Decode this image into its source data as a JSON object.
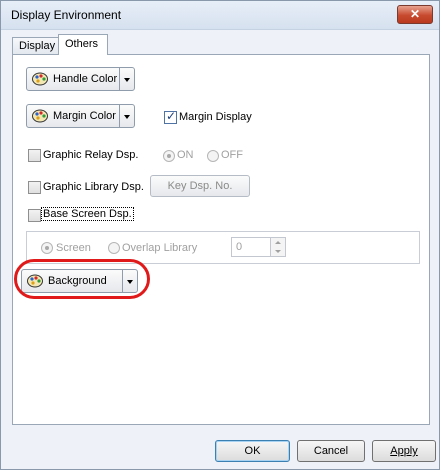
{
  "window": {
    "title": "Display Environment",
    "close_glyph": "✕"
  },
  "tabs": [
    {
      "label": "Display"
    },
    {
      "label": "Others",
      "active": true
    }
  ],
  "others": {
    "handle_color": {
      "label": "Handle Color",
      "icon": "palette-icon"
    },
    "margin_color": {
      "label": "Margin Color",
      "icon": "palette-icon"
    },
    "margin_display": {
      "label": "Margin Display",
      "checked": true
    },
    "graphic_relay": {
      "label": "Graphic Relay Dsp.",
      "checked": false,
      "on_label": "ON",
      "off_label": "OFF",
      "selected": "ON"
    },
    "graphic_library": {
      "label": "Graphic Library Dsp.",
      "checked": false,
      "key_button": "Key Dsp. No."
    },
    "base_screen": {
      "label": "Base Screen Dsp.",
      "checked": false,
      "screen_label": "Screen",
      "overlap_label": "Overlap Library",
      "selected": "Screen",
      "number": "0"
    },
    "background": {
      "label": "Background",
      "icon": "palette-icon"
    }
  },
  "footer": {
    "ok": "OK",
    "cancel": "Cancel",
    "apply": "Apply"
  },
  "colors": {
    "highlight": "#e01a1a",
    "close_button": "#c74a2f",
    "checkbox_accent": "#1d3f7a"
  }
}
